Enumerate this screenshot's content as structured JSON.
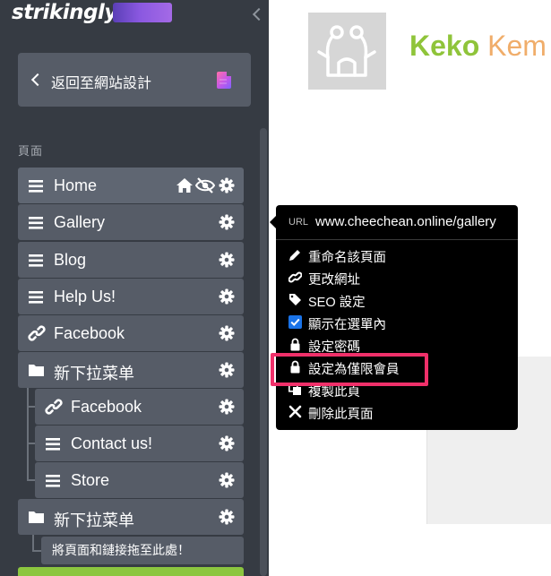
{
  "app": {
    "logo_text": "strikingly",
    "colors": {
      "sidebar_bg": "#363b43",
      "item_bg": "#565c67",
      "accent_green": "#8cc63f",
      "highlight": "#f0306a"
    }
  },
  "sidebar": {
    "back_button_label": "返回至網站設計",
    "section_label": "頁面",
    "items": [
      {
        "label": "Home",
        "icon": "hamburger-icon",
        "extra_icons": [
          "home-icon",
          "eye-slash-icon"
        ]
      },
      {
        "label": "Gallery",
        "icon": "hamburger-icon"
      },
      {
        "label": "Blog",
        "icon": "hamburger-icon"
      },
      {
        "label": "Help Us!",
        "icon": "hamburger-icon"
      },
      {
        "label": "Facebook",
        "icon": "link-icon"
      },
      {
        "label": "新下拉菜单",
        "icon": "folder-icon"
      },
      {
        "label": "Facebook",
        "icon": "link-icon",
        "nested": true
      },
      {
        "label": "Contact us!",
        "icon": "hamburger-icon",
        "nested": true
      },
      {
        "label": "Store",
        "icon": "hamburger-icon",
        "nested": true
      },
      {
        "label": "新下拉菜单",
        "icon": "folder-icon"
      }
    ],
    "drop_hint": "將頁面和鏈接拖至此處！"
  },
  "popover": {
    "url_tag": "URL",
    "url": "www.cheechean.online/gallery",
    "menu": [
      {
        "label": "重命名該頁面",
        "icon": "pencil-icon"
      },
      {
        "label": "更改網址",
        "icon": "link-icon"
      },
      {
        "label": "SEO 設定",
        "icon": "tag-icon"
      },
      {
        "label": "顯示在選單內",
        "icon": "checkbox-checked-icon"
      },
      {
        "label": "設定密碼",
        "icon": "lock-icon"
      },
      {
        "label": "設定為僅限會員",
        "icon": "lock-icon"
      },
      {
        "label": "複製此頁",
        "icon": "copy-icon"
      },
      {
        "label": "刪除此頁面",
        "icon": "x-icon"
      }
    ]
  },
  "content": {
    "brand_part1": "Keko",
    "brand_part2": "Kem"
  }
}
